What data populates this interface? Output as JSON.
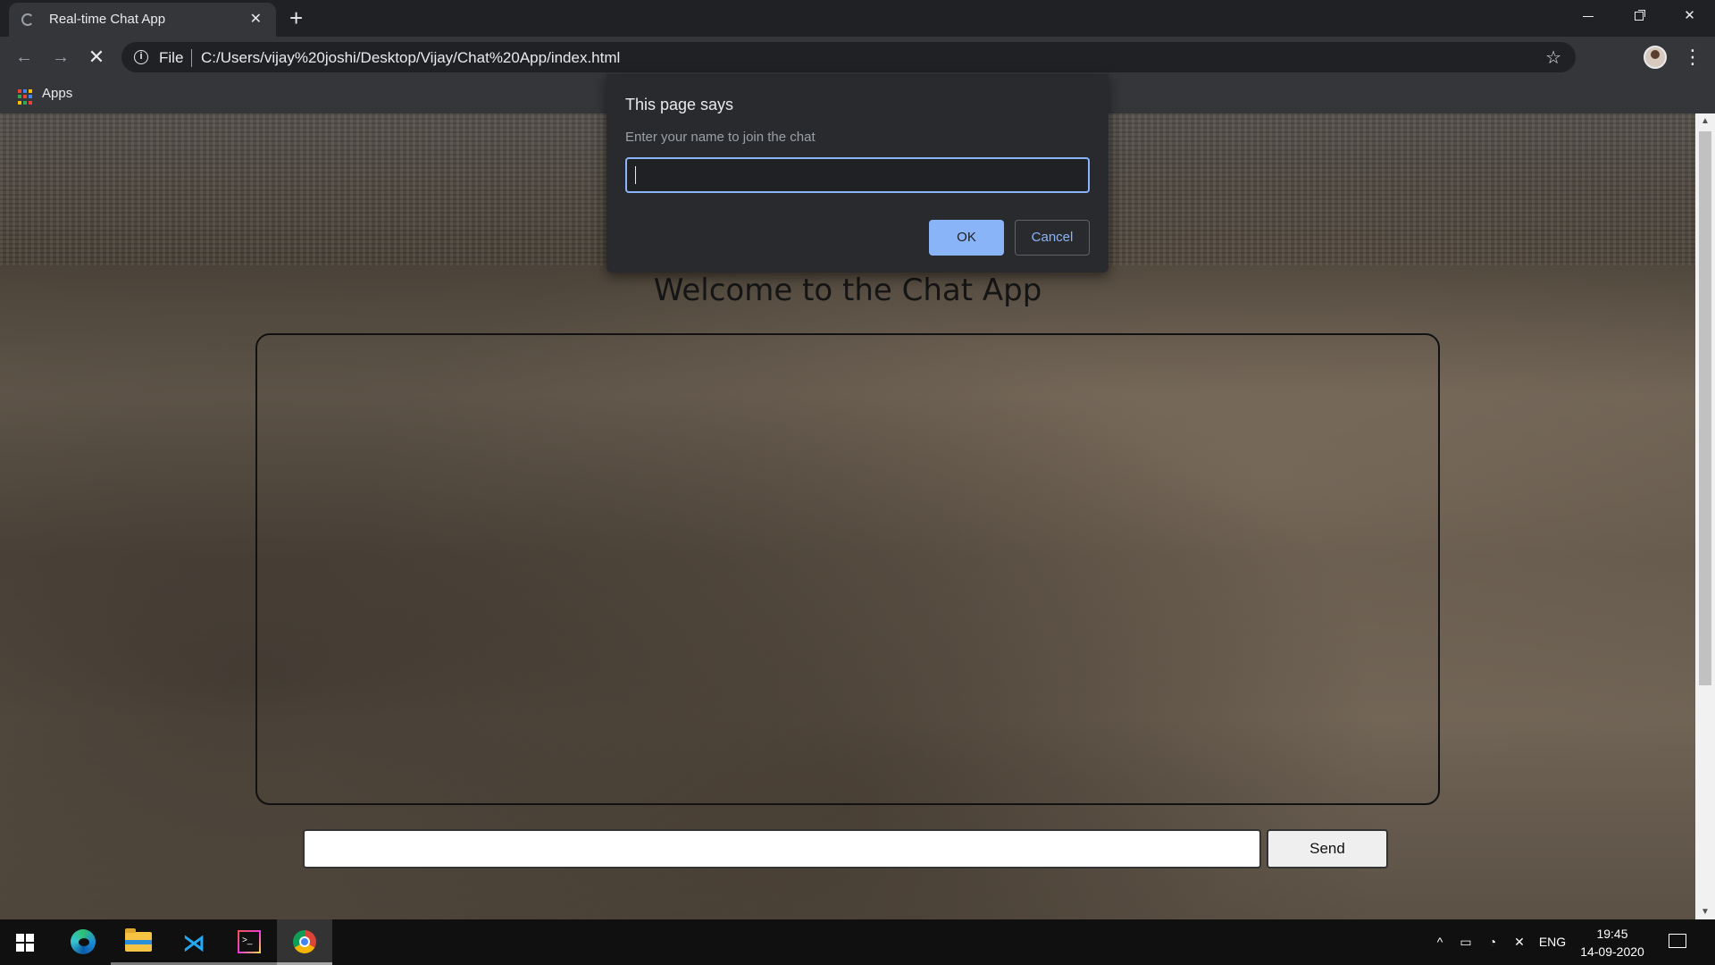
{
  "browser": {
    "tab": {
      "title": "Real-time Chat App",
      "favicon": "page-loading-icon"
    },
    "address": {
      "scheme_label": "File",
      "url": "C:/Users/vijay%20joshi/Desktop/Vijay/Chat%20App/index.html"
    },
    "bookmarks": {
      "apps_label": "Apps"
    }
  },
  "page": {
    "title": "Welcome to the Chat App",
    "message_input": {
      "value": "",
      "placeholder": ""
    },
    "send_label": "Send"
  },
  "dialog": {
    "title": "This page says",
    "message": "Enter your name to join the chat",
    "input_value": "",
    "ok_label": "OK",
    "cancel_label": "Cancel"
  },
  "taskbar": {
    "apps": [
      "edge-icon",
      "file-explorer-icon",
      "vscode-icon",
      "terminal-icon",
      "chrome-icon"
    ],
    "language": "ENG",
    "time": "19:45",
    "date": "14-09-2020"
  },
  "colors": {
    "dialog_accent": "#8ab4f8",
    "browser_frame": "#202124",
    "toolbar": "#35363a"
  }
}
